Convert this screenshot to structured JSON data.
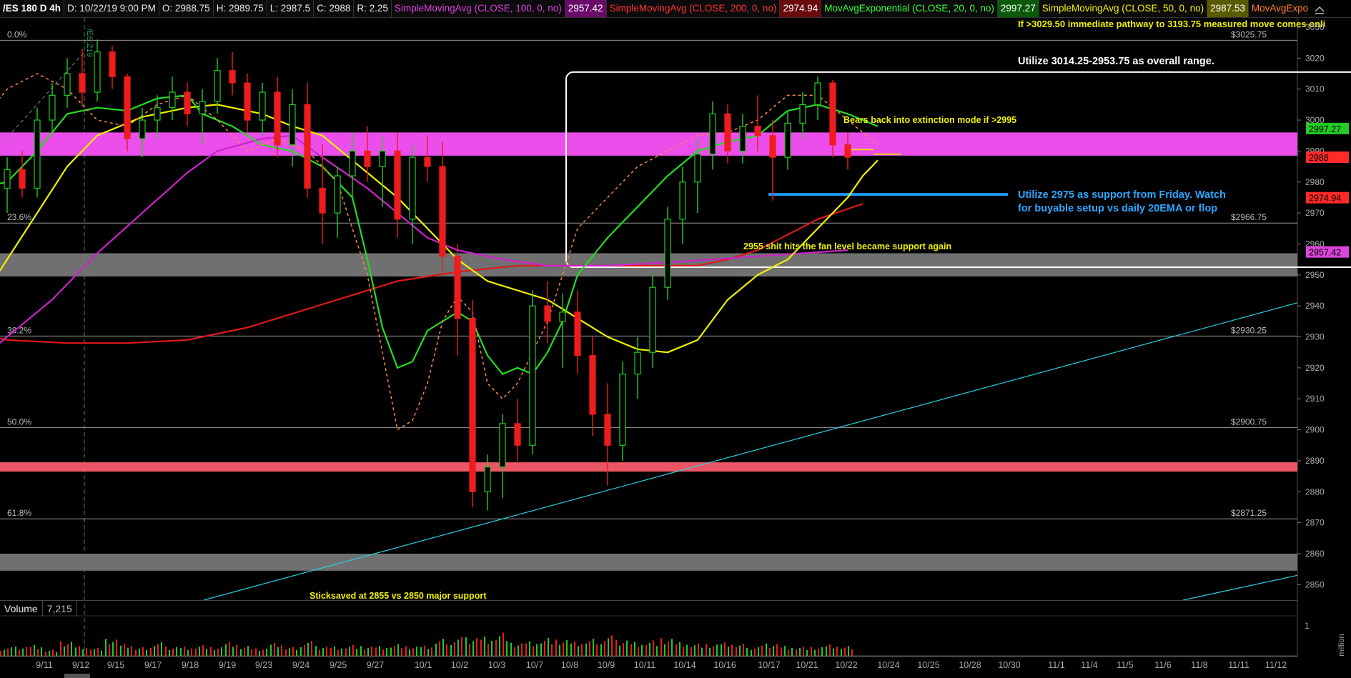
{
  "header": {
    "symbol": "/ES 180 D 4h",
    "datetime": "D: 10/22/19 9:00 PM",
    "open": "O: 2988.75",
    "high": "H: 2989.75",
    "low": "L: 2987.5",
    "close": "C: 2988",
    "range": "R: 2.25",
    "studies": [
      {
        "label": "SimpleMovingAvg (CLOSE, 100, 0, no)",
        "value": "2957.42"
      },
      {
        "label": "SimpleMovingAvg (CLOSE, 200, 0, no)",
        "value": "2974.94"
      },
      {
        "label": "MovAvgExponential (CLOSE, 20, 0, no)",
        "value": "2997.27"
      },
      {
        "label": "SimpleMovingAvg (CLOSE, 50, 0, no)",
        "value": "2987.53"
      },
      {
        "label": "MovAvgExponential ..."
      }
    ]
  },
  "volume": {
    "label": "Volume",
    "value": "7,215",
    "scale_label": "1",
    "unit_label": "<million"
  },
  "annotations": [
    {
      "text": "If >3029.50 immediate pathway to 3193.75 measured move comes onli",
      "color": "#f0f000"
    },
    {
      "text": "Utilize 3014.25-2953.75 as overall range.",
      "color": "#ffffff"
    },
    {
      "text": "Bears back into extinction mode if >2995",
      "color": "#f0f000"
    },
    {
      "text": "Utilize 2975 as support from Friday. Watch",
      "color": "#2aa7ff"
    },
    {
      "text": "for buyable setup vs daily 20EMA or flop",
      "color": "#2aa7ff"
    },
    {
      "text": "2955 shit hits the fan level became support again",
      "color": "#f0f000"
    },
    {
      "text": "Sticksaved at 2855 vs 2850 major support",
      "color": "#f0f000"
    }
  ],
  "vertical_marker_label": "/ES:Z19",
  "chart_data": {
    "type": "candlestick",
    "ylim": [
      2845,
      3033
    ],
    "y_ticks": [
      2850,
      2860,
      2870,
      2880,
      2890,
      2900,
      2910,
      2920,
      2930,
      2940,
      2950,
      2960,
      2970,
      2980,
      2990,
      3000,
      3010,
      3020,
      3030
    ],
    "x_labels": [
      "9/11",
      "9/12",
      "9/15",
      "9/17",
      "9/18",
      "9/19",
      "9/23",
      "9/24",
      "9/25",
      "9/27",
      "10/1",
      "10/2",
      "10/3",
      "10/7",
      "10/8",
      "10/9",
      "10/11",
      "10/14",
      "10/16",
      "10/17",
      "10/21",
      "10/22",
      "10/24",
      "10/25",
      "10/28",
      "10/30",
      "11/1",
      "11/4",
      "11/5",
      "11/6",
      "11/8",
      "11/11",
      "11/12"
    ],
    "fib_levels": [
      {
        "pct": "0.0%",
        "price": "$3025.75",
        "y": 3025.75
      },
      {
        "pct": "23.6%",
        "price": "$2966.75",
        "y": 2966.75
      },
      {
        "pct": "38.2%",
        "price": "$2930.25",
        "y": 2930.25
      },
      {
        "pct": "50.0%",
        "price": "$2900.75",
        "y": 2900.75
      },
      {
        "pct": "61.8%",
        "price": "$2871.25",
        "y": 2871.25
      }
    ],
    "zones": [
      {
        "from": 2988.5,
        "to": 2996.0,
        "color": "#ff55ff"
      },
      {
        "from": 2949.5,
        "to": 2957.0,
        "color": "#7a7a7a"
      },
      {
        "from": 2886.5,
        "to": 2889.5,
        "color": "#ff5c6c"
      },
      {
        "from": 2854.5,
        "to": 2860.0,
        "color": "#7a7a7a"
      }
    ],
    "price_badges": [
      {
        "value": "2997.27",
        "y": 2997.27,
        "bg": "#22cc22",
        "fg": "#000"
      },
      {
        "value": "2988",
        "y": 2988,
        "bg": "#ff2a2a",
        "fg": "#000"
      },
      {
        "value": "2974.94",
        "y": 2974.94,
        "bg": "#ff2a2a",
        "fg": "#000"
      },
      {
        "value": "2957.42",
        "y": 2957.42,
        "bg": "#dd44dd",
        "fg": "#000"
      }
    ],
    "series": [
      {
        "name": "SMA 200",
        "color": "#e01818",
        "points": [
          [
            -2,
            2931
          ],
          [
            0,
            2929
          ],
          [
            4,
            2928
          ],
          [
            8,
            2928
          ],
          [
            12,
            2929
          ],
          [
            16,
            2933
          ],
          [
            20,
            2939
          ],
          [
            24,
            2945
          ],
          [
            26,
            2948
          ],
          [
            30,
            2951
          ],
          [
            34,
            2953
          ],
          [
            38,
            2953
          ],
          [
            42,
            2953
          ],
          [
            46,
            2953
          ],
          [
            48,
            2955
          ],
          [
            50,
            2958
          ],
          [
            52,
            2963
          ],
          [
            54,
            2968
          ],
          [
            57,
            2973
          ]
        ]
      },
      {
        "name": "SMA 100",
        "color": "#cc22cc",
        "points": [
          [
            -2,
            2922
          ],
          [
            0,
            2930
          ],
          [
            3,
            2942
          ],
          [
            6,
            2957
          ],
          [
            9,
            2970
          ],
          [
            12,
            2983
          ],
          [
            14,
            2990
          ],
          [
            17,
            2994
          ],
          [
            19,
            2995
          ],
          [
            21,
            2988
          ],
          [
            24,
            2978
          ],
          [
            26,
            2970
          ],
          [
            28,
            2962
          ],
          [
            30,
            2958
          ],
          [
            33,
            2955
          ],
          [
            36,
            2953
          ],
          [
            40,
            2953
          ],
          [
            44,
            2954
          ],
          [
            47,
            2955
          ],
          [
            50,
            2956
          ],
          [
            53,
            2957
          ],
          [
            56,
            2958
          ]
        ]
      },
      {
        "name": "SMA 50",
        "color": "#f0f000",
        "points": [
          [
            -2,
            2940
          ],
          [
            0,
            2955
          ],
          [
            2,
            2970
          ],
          [
            4,
            2985
          ],
          [
            6,
            2995
          ],
          [
            9,
            3001
          ],
          [
            12,
            3004
          ],
          [
            14,
            3005
          ],
          [
            17,
            3002
          ],
          [
            19,
            2998
          ],
          [
            21,
            2995
          ],
          [
            23,
            2987
          ],
          [
            26,
            2975
          ],
          [
            28,
            2965
          ],
          [
            30,
            2955
          ],
          [
            32,
            2948
          ],
          [
            34,
            2945
          ],
          [
            36,
            2942
          ],
          [
            38,
            2936
          ],
          [
            40,
            2930
          ],
          [
            42,
            2926
          ],
          [
            44,
            2925
          ],
          [
            46,
            2929
          ],
          [
            48,
            2942
          ],
          [
            50,
            2950
          ],
          [
            52,
            2955
          ],
          [
            54,
            2965
          ],
          [
            56,
            2975
          ],
          [
            57,
            2982
          ],
          [
            58,
            2987
          ]
        ]
      },
      {
        "name": "EMA 20",
        "color": "#22dd22",
        "points": [
          [
            -2,
            2978
          ],
          [
            0,
            2980
          ],
          [
            2,
            2990
          ],
          [
            4,
            3002
          ],
          [
            6,
            3004
          ],
          [
            8,
            3003
          ],
          [
            10,
            3007
          ],
          [
            12,
            3008
          ],
          [
            13,
            3002
          ],
          [
            15,
            2998
          ],
          [
            17,
            2992
          ],
          [
            19,
            2990
          ],
          [
            21,
            2985
          ],
          [
            23,
            2975
          ],
          [
            24,
            2955
          ],
          [
            25,
            2933
          ],
          [
            26,
            2920
          ],
          [
            27,
            2922
          ],
          [
            28,
            2932
          ],
          [
            29,
            2935
          ],
          [
            30,
            2938
          ],
          [
            31,
            2935
          ],
          [
            32,
            2924
          ],
          [
            33,
            2918
          ],
          [
            34,
            2920
          ],
          [
            35,
            2918
          ],
          [
            36,
            2925
          ],
          [
            37,
            2935
          ],
          [
            38,
            2950
          ],
          [
            40,
            2962
          ],
          [
            42,
            2972
          ],
          [
            44,
            2982
          ],
          [
            46,
            2990
          ],
          [
            48,
            2993
          ],
          [
            50,
            2995
          ],
          [
            52,
            3003
          ],
          [
            54,
            3005
          ],
          [
            56,
            3002
          ],
          [
            58,
            2998
          ]
        ]
      },
      {
        "name": "EMA dashed",
        "color": "#ff8844",
        "dashed": true,
        "points": [
          [
            -2,
            2998
          ],
          [
            0,
            3010
          ],
          [
            2,
            3015
          ],
          [
            4,
            3010
          ],
          [
            6,
            3000
          ],
          [
            8,
            2998
          ],
          [
            10,
            3005
          ],
          [
            12,
            3008
          ],
          [
            14,
            3000
          ],
          [
            16,
            2990
          ],
          [
            18,
            2994
          ],
          [
            20,
            2990
          ],
          [
            22,
            2980
          ],
          [
            24,
            2950
          ],
          [
            25,
            2925
          ],
          [
            26,
            2900
          ],
          [
            27,
            2903
          ],
          [
            28,
            2915
          ],
          [
            29,
            2935
          ],
          [
            30,
            2943
          ],
          [
            31,
            2938
          ],
          [
            32,
            2915
          ],
          [
            33,
            2910
          ],
          [
            34,
            2915
          ],
          [
            35,
            2925
          ],
          [
            36,
            2935
          ],
          [
            37,
            2950
          ],
          [
            38,
            2965
          ],
          [
            39,
            2970
          ],
          [
            40,
            2975
          ],
          [
            42,
            2985
          ],
          [
            44,
            2990
          ],
          [
            46,
            2995
          ],
          [
            48,
            2996
          ],
          [
            50,
            3000
          ],
          [
            52,
            3008
          ],
          [
            54,
            3008
          ],
          [
            56,
            3000
          ],
          [
            58,
            2992
          ]
        ]
      }
    ],
    "candles": [
      [
        2978,
        2988,
        2970,
        2984
      ],
      [
        2984,
        2990,
        2975,
        2978
      ],
      [
        2978,
        3004,
        2975,
        3000
      ],
      [
        3000,
        3012,
        2996,
        3008
      ],
      [
        3008,
        3020,
        3004,
        3015
      ],
      [
        3015,
        3023,
        3005,
        3009
      ],
      [
        3009,
        3026,
        3006,
        3022
      ],
      [
        3022,
        3024,
        3010,
        3014
      ],
      [
        3014,
        3015,
        2990,
        2994
      ],
      [
        2994,
        3004,
        2988,
        3000
      ],
      [
        3000,
        3008,
        2994,
        3004
      ],
      [
        3004,
        3014,
        3000,
        3009
      ],
      [
        3009,
        3012,
        2998,
        3002
      ],
      [
        3002,
        3010,
        2992,
        3006
      ],
      [
        3006,
        3020,
        3002,
        3016
      ],
      [
        3016,
        3022,
        3008,
        3012
      ],
      [
        3012,
        3015,
        2996,
        3000
      ],
      [
        3000,
        3012,
        2995,
        3009
      ],
      [
        3009,
        3014,
        2988,
        2992
      ],
      [
        2992,
        3010,
        2985,
        3005
      ],
      [
        3005,
        3012,
        2975,
        2978
      ],
      [
        2978,
        2992,
        2960,
        2970
      ],
      [
        2970,
        2985,
        2962,
        2982
      ],
      [
        2982,
        2996,
        2975,
        2990
      ],
      [
        2990,
        2998,
        2980,
        2985
      ],
      [
        2985,
        2995,
        2972,
        2990
      ],
      [
        2990,
        2996,
        2962,
        2968
      ],
      [
        2968,
        2992,
        2960,
        2988
      ],
      [
        2988,
        2995,
        2980,
        2985
      ],
      [
        2985,
        2993,
        2950,
        2956
      ],
      [
        2956,
        2960,
        2924,
        2936
      ],
      [
        2936,
        2942,
        2875,
        2880
      ],
      [
        2880,
        2892,
        2874,
        2888
      ],
      [
        2888,
        2905,
        2878,
        2902
      ],
      [
        2902,
        2910,
        2890,
        2895
      ],
      [
        2895,
        2945,
        2892,
        2940
      ],
      [
        2940,
        2948,
        2928,
        2935
      ],
      [
        2935,
        2944,
        2920,
        2938
      ],
      [
        2938,
        2945,
        2918,
        2924
      ],
      [
        2924,
        2930,
        2898,
        2905
      ],
      [
        2905,
        2915,
        2882,
        2895
      ],
      [
        2895,
        2922,
        2890,
        2918
      ],
      [
        2918,
        2930,
        2910,
        2925
      ],
      [
        2925,
        2950,
        2920,
        2946
      ],
      [
        2946,
        2972,
        2942,
        2968
      ],
      [
        2968,
        2985,
        2960,
        2980
      ],
      [
        2980,
        2994,
        2970,
        2989
      ],
      [
        2989,
        3006,
        2984,
        3002
      ],
      [
        3002,
        3005,
        2986,
        2990
      ],
      [
        2990,
        3002,
        2986,
        2998
      ],
      [
        2998,
        3008,
        2990,
        2995
      ],
      [
        2995,
        3000,
        2974,
        2988
      ],
      [
        2988,
        3003,
        2984,
        2999
      ],
      [
        2999,
        3009,
        2994,
        3005
      ],
      [
        3005,
        3014,
        3000,
        3012
      ],
      [
        3012,
        3013,
        2988,
        2992
      ],
      [
        2992,
        2996,
        2984,
        2988
      ]
    ],
    "volume_bars": [
      0.25,
      0.3,
      0.35,
      0.2,
      0.45,
      0.3,
      0.25,
      0.5,
      0.35,
      0.25,
      0.4,
      0.3,
      0.3,
      0.35,
      0.28,
      0.42,
      0.3,
      0.22,
      0.38,
      0.26,
      0.44,
      0.32,
      0.3,
      0.35,
      0.3,
      0.3,
      0.36,
      0.28,
      0.3,
      0.5,
      0.55,
      0.6,
      0.62,
      0.75,
      0.4,
      0.45,
      0.55,
      0.48,
      0.42,
      0.5,
      0.6,
      0.52,
      0.45,
      0.5,
      0.55,
      0.42,
      0.38,
      0.35,
      0.4,
      0.35,
      0.3,
      0.4,
      0.32,
      0.3,
      0.28,
      0.35,
      0.3
    ]
  }
}
